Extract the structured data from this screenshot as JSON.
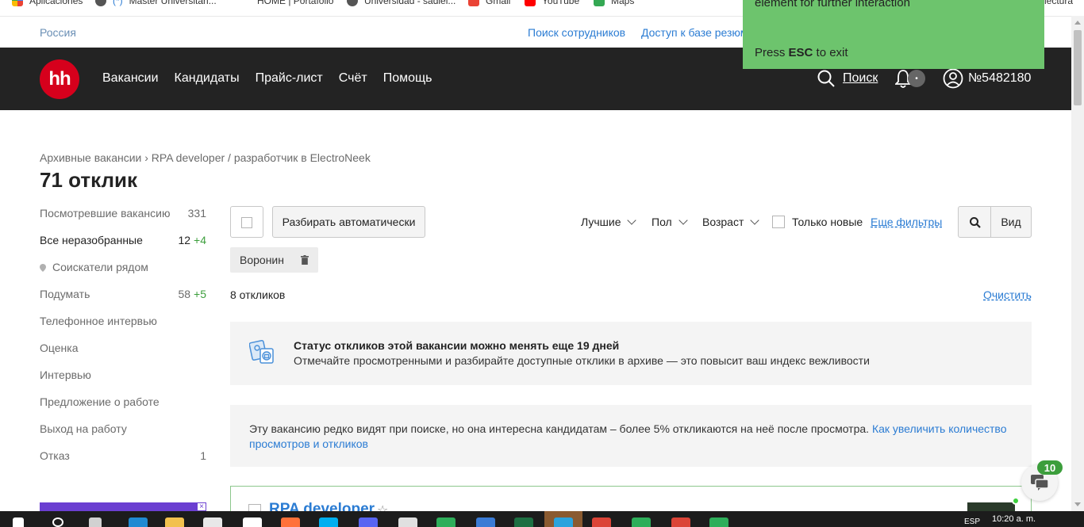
{
  "bookmarks": [
    "Aplicaciones",
    "Master Universitari...",
    "HOME | Portafolio",
    "Universidad - sadiel...",
    "Gmail",
    "YouTube",
    "Maps"
  ],
  "bookmarks_trailing": "lectura",
  "toast": {
    "line1": "element for further interaction",
    "line2_prefix": "Press ",
    "line2_key": "ESC",
    "line2_suffix": " to exit"
  },
  "utility": {
    "region": "Россия",
    "find_staff": "Поиск сотрудников",
    "resume_access": "Доступ к базе резюме"
  },
  "header": {
    "logo": "hh",
    "nav": [
      "Вакансии",
      "Кандидаты",
      "Прайс-лист",
      "Счёт",
      "Помощь"
    ],
    "search_label": "Поиск",
    "account": "№5482180",
    "brand_color": "#d6001c"
  },
  "breadcrumb": "Архивные вакансии › RPA developer / разработчик в ElectroNeek",
  "page_title": "71 отклик",
  "sidebar": [
    {
      "label": "Посмотревшие вакансию",
      "count": "331",
      "plus": ""
    },
    {
      "label": "Все неразобранные",
      "count": "12",
      "plus": "+4"
    },
    {
      "label": "Соискатели рядом",
      "count": "",
      "plus": ""
    },
    {
      "label": "Подумать",
      "count": "58",
      "plus": "+5"
    },
    {
      "label": "Телефонное интервью",
      "count": "",
      "plus": ""
    },
    {
      "label": "Оценка",
      "count": "",
      "plus": ""
    },
    {
      "label": "Интервью",
      "count": "",
      "plus": ""
    },
    {
      "label": "Предложение о работе",
      "count": "",
      "plus": ""
    },
    {
      "label": "Выход на работу",
      "count": "",
      "plus": ""
    },
    {
      "label": "Отказ",
      "count": "1",
      "plus": ""
    }
  ],
  "toolbar": {
    "auto_sort": "Разбирать автоматически",
    "sort_best": "Лучшие",
    "gender": "Пол",
    "age": "Возраст",
    "only_new": "Только новые",
    "more_filters": "Еще фильтры",
    "view": "Вид"
  },
  "filter_chip": "Воронин",
  "results": {
    "count": "8 откликов",
    "clear": "Очистить"
  },
  "notice": {
    "title": "Статус откликов этой вакансии можно менять еще 19 дней",
    "text": "Отмечайте просмотренными и разбирайте доступные отклики в архиве — это повысит ваш индекс вежливости"
  },
  "info": {
    "text": "Эту вакансию редко видят при поиске, но она интересна кандидатам – более 5% откликаются на неё после просмотра. ",
    "link": "Как увеличить количество просмотров и откликов"
  },
  "card": {
    "title": "RPA developer"
  },
  "chat_badge": "10",
  "taskbar": {
    "lang": "ESP",
    "time": "10:20 a. m."
  }
}
